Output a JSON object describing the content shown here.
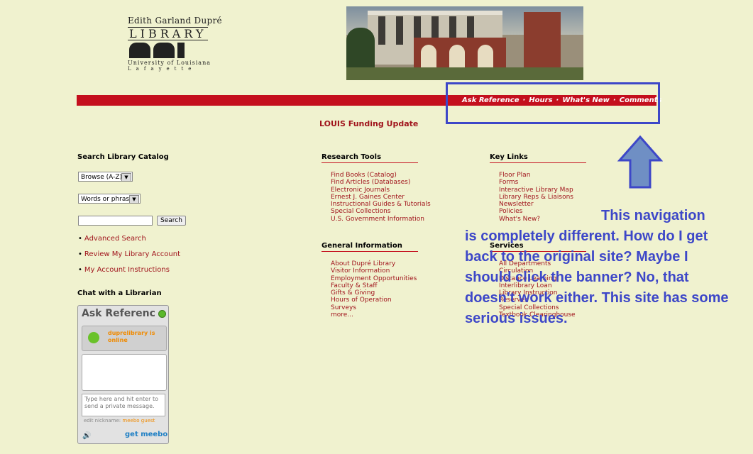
{
  "logo": {
    "line1": "Edith Garland Dupré",
    "line2": "LIBRARY",
    "line3": "University of Louisiana",
    "line4": "Lafayette"
  },
  "topnav": [
    "Ask Reference",
    "Hours",
    "What's New",
    "Comments"
  ],
  "funding": "LOUIS Funding Update",
  "search": {
    "heading": "Search Library Catalog",
    "browse_select": "Browse (A-Z)",
    "words_select": "Words or phrase",
    "input_value": "",
    "button": "Search",
    "links": [
      "Advanced Search",
      "Review My Library Account",
      "My Account Instructions"
    ]
  },
  "chat": {
    "heading": "Chat with a Librarian",
    "widget_title": "Ask Referenc",
    "status": "duprelibrary is online",
    "input_hint": "Type here and hit enter to send a private message.",
    "nick_label": "edit nickname:",
    "nick_value": "meebo guest",
    "brand": "get meebo"
  },
  "research": {
    "heading": "Research Tools",
    "items": [
      "Find Books (Catalog)",
      "Find Articles (Databases)",
      "Electronic Journals",
      "Ernest J. Gaines Center",
      "Instructional Guides & Tutorials",
      "Special Collections",
      "U.S. Government Information"
    ]
  },
  "general": {
    "heading": "General Information",
    "items": [
      "About Dupré Library",
      "Visitor Information",
      "Employment Opportunities",
      "Faculty & Staff",
      "Gifts & Giving",
      "Hours of Operation",
      "Surveys",
      "more..."
    ]
  },
  "keylinks": {
    "heading": "Key Links",
    "items": [
      "Floor Plan",
      "Forms",
      "Interactive Library Map",
      "Library Reps & Liaisons",
      "Newsletter",
      "Policies",
      "What's New?"
    ]
  },
  "services": {
    "heading": "Services",
    "items": [
      "All Departments",
      "Circulation",
      "Distance Learning",
      "Interlibrary Loan",
      "Library Instruction",
      "Reserves",
      "Special Collections",
      "Textbook Clearinghouse"
    ]
  },
  "annotation": {
    "text_first": "This navigation",
    "text_rest": "is completely different. How do I get back to the original site? Maybe I should click the banner? No, that doesn't work either. This site has some serious issues.",
    "color": "#3d47c8"
  }
}
